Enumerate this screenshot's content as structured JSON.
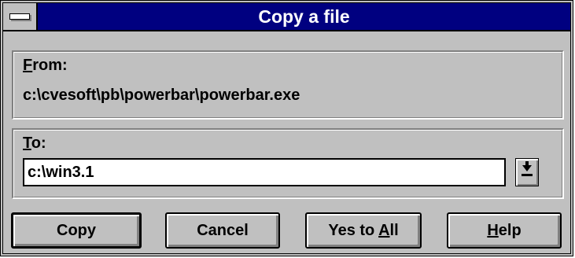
{
  "window": {
    "title": "Copy a file"
  },
  "from": {
    "label_underline": "F",
    "label_rest": "rom:",
    "path": "c:\\cvesoft\\pb\\powerbar\\powerbar.exe"
  },
  "to": {
    "label_underline": "T",
    "label_rest": "o:",
    "value": "c:\\win3.1"
  },
  "buttons": {
    "copy": "Copy",
    "cancel": "Cancel",
    "yes_to_all_pre": "Yes to ",
    "yes_to_all_underline": "A",
    "yes_to_all_post": "ll",
    "help_underline": "H",
    "help_rest": "elp"
  },
  "icons": {
    "system_menu": "system-menu-icon",
    "combo_dropdown": "dropdown-arrow-icon"
  }
}
